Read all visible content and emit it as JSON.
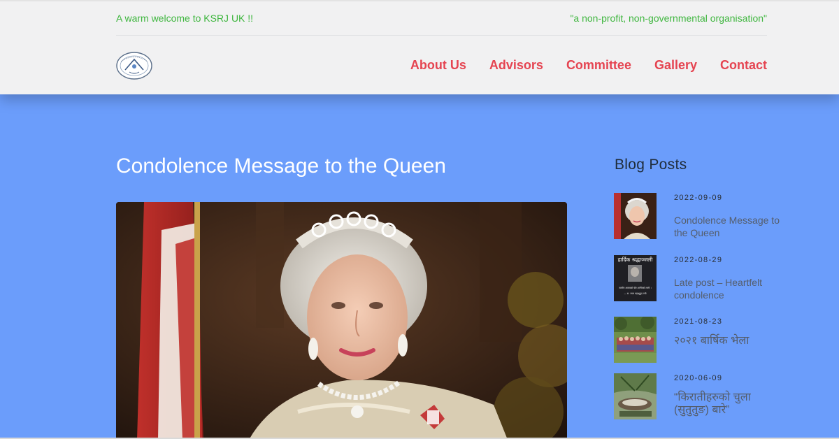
{
  "topbar": {
    "welcome": "A warm welcome to KSRJ UK !!",
    "tagline": "\"a non-profit, non-governmental organisation\""
  },
  "nav": {
    "items": [
      "About Us",
      "Advisors",
      "Committee",
      "Gallery",
      "Contact"
    ]
  },
  "colors": {
    "accent": "#e54451",
    "topbar_text": "#3fb63f",
    "page_background": "#6b9dfb",
    "header_background": "#f1f1f2"
  },
  "post": {
    "title": "Condolence Message to the Queen"
  },
  "sidebar": {
    "title": "Blog Posts",
    "posts": [
      {
        "date": "2022-09-09",
        "title": "Condolence Message to the Queen"
      },
      {
        "date": "2022-08-29",
        "title": "Late post – Heartfelt condolence"
      },
      {
        "date": "2021-08-23",
        "title": "२०२१ बार्षिक भेला"
      },
      {
        "date": "2020-06-09",
        "title": "“किरातीहरुको चुला (सुतुतुङ) बारे”"
      }
    ],
    "thumb_texts": {
      "heading": "हार्दिक श्रद्धाञ्जली",
      "line1": "स्वर्गीय आत्माको चीर शान्तिको लागी ।",
      "line2": "— स. राजा महाशुदुद ज्यो"
    }
  }
}
